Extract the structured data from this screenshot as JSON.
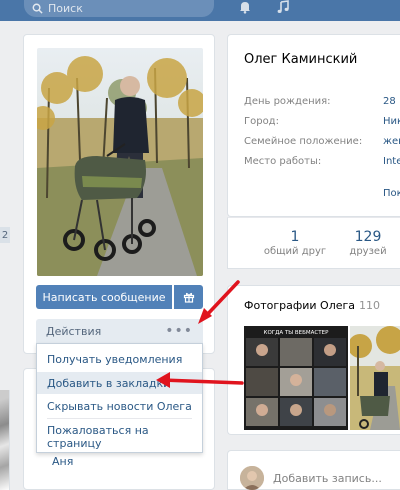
{
  "header": {
    "search_placeholder": "Поиск",
    "icons": [
      "search-icon",
      "bell-icon",
      "music-icon"
    ]
  },
  "left_stub": {
    "badge": "2"
  },
  "profile": {
    "name": "Олег Каминский",
    "info": [
      {
        "label": "День рождения:",
        "value": "28 "
      },
      {
        "label": "Город:",
        "value": "Ник"
      },
      {
        "label": "Семейное положение:",
        "value": "жен"
      },
      {
        "label": "Место работы:",
        "value": "Inte"
      }
    ],
    "more_link": "Пок",
    "counters": [
      {
        "num": "1",
        "label": "общий друг"
      },
      {
        "num": "129",
        "label": "друзей"
      }
    ]
  },
  "buttons": {
    "message": "Написать сообщение",
    "actions": "Действия",
    "actions_dots": "•••"
  },
  "dropdown": {
    "items": [
      "Получать уведомления",
      "Добавить в закладки",
      "Скрывать новости Олега",
      "Пожаловаться на страницу"
    ],
    "highlighted_index": 1
  },
  "friends": {
    "visible_name": "Аня"
  },
  "photos": {
    "title": "Фотографии Олега",
    "count": "110",
    "thumbnail_caption": "КОГДА ТЫ ВЕБМАСТЕР"
  },
  "wall": {
    "placeholder": "Добавить запись..."
  },
  "colors": {
    "topbar": "#4a76a8",
    "button": "#5181b8",
    "link": "#2a5885",
    "annotation_arrow": "#e0141e"
  }
}
